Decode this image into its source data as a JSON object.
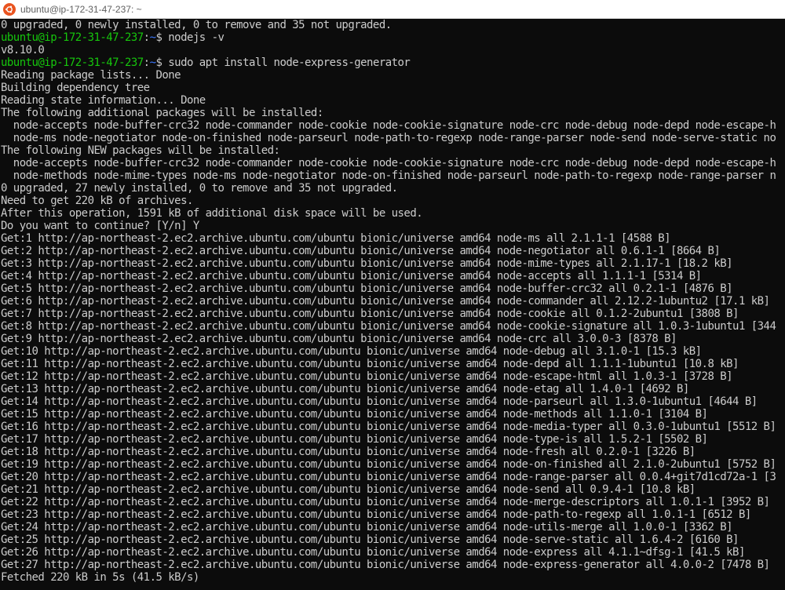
{
  "window": {
    "title": "ubuntu@ip-172-31-47-237: ~",
    "app_icon": "ubuntu-logo-icon",
    "accent": "#e95420"
  },
  "colors": {
    "background": "#0c0c0c",
    "text": "#cccccc",
    "prompt_user": "#16c60c",
    "prompt_path": "#3b78ff"
  },
  "terminal": {
    "lines": [
      {
        "type": "out",
        "text": "0 upgraded, 0 newly installed, 0 to remove and 35 not upgraded."
      },
      {
        "type": "prompt",
        "user": "ubuntu@ip-172-31-47-237",
        "sep": ":",
        "path": "~",
        "cmd": "$ nodejs -v"
      },
      {
        "type": "out",
        "text": "v8.10.0"
      },
      {
        "type": "prompt",
        "user": "ubuntu@ip-172-31-47-237",
        "sep": ":",
        "path": "~",
        "cmd": "$ sudo apt install node-express-generator"
      },
      {
        "type": "out",
        "text": "Reading package lists... Done"
      },
      {
        "type": "out",
        "text": "Building dependency tree"
      },
      {
        "type": "out",
        "text": "Reading state information... Done"
      },
      {
        "type": "out",
        "text": "The following additional packages will be installed:"
      },
      {
        "type": "out",
        "text": "  node-accepts node-buffer-crc32 node-commander node-cookie node-cookie-signature node-crc node-debug node-depd node-escape-h"
      },
      {
        "type": "out",
        "text": "  node-ms node-negotiator node-on-finished node-parseurl node-path-to-regexp node-range-parser node-send node-serve-static no"
      },
      {
        "type": "out",
        "text": "The following NEW packages will be installed:"
      },
      {
        "type": "out",
        "text": "  node-accepts node-buffer-crc32 node-commander node-cookie node-cookie-signature node-crc node-debug node-depd node-escape-h"
      },
      {
        "type": "out",
        "text": "  node-methods node-mime-types node-ms node-negotiator node-on-finished node-parseurl node-path-to-regexp node-range-parser n"
      },
      {
        "type": "out",
        "text": "0 upgraded, 27 newly installed, 0 to remove and 35 not upgraded."
      },
      {
        "type": "out",
        "text": "Need to get 220 kB of archives."
      },
      {
        "type": "out",
        "text": "After this operation, 1591 kB of additional disk space will be used."
      },
      {
        "type": "out",
        "text": "Do you want to continue? [Y/n] Y"
      },
      {
        "type": "out",
        "text": "Get:1 http://ap-northeast-2.ec2.archive.ubuntu.com/ubuntu bionic/universe amd64 node-ms all 2.1.1-1 [4588 B]"
      },
      {
        "type": "out",
        "text": "Get:2 http://ap-northeast-2.ec2.archive.ubuntu.com/ubuntu bionic/universe amd64 node-negotiator all 0.6.1-1 [8664 B]"
      },
      {
        "type": "out",
        "text": "Get:3 http://ap-northeast-2.ec2.archive.ubuntu.com/ubuntu bionic/universe amd64 node-mime-types all 2.1.17-1 [18.2 kB]"
      },
      {
        "type": "out",
        "text": "Get:4 http://ap-northeast-2.ec2.archive.ubuntu.com/ubuntu bionic/universe amd64 node-accepts all 1.1.1-1 [5314 B]"
      },
      {
        "type": "out",
        "text": "Get:5 http://ap-northeast-2.ec2.archive.ubuntu.com/ubuntu bionic/universe amd64 node-buffer-crc32 all 0.2.1-1 [4876 B]"
      },
      {
        "type": "out",
        "text": "Get:6 http://ap-northeast-2.ec2.archive.ubuntu.com/ubuntu bionic/universe amd64 node-commander all 2.12.2-1ubuntu2 [17.1 kB]"
      },
      {
        "type": "out",
        "text": "Get:7 http://ap-northeast-2.ec2.archive.ubuntu.com/ubuntu bionic/universe amd64 node-cookie all 0.1.2-2ubuntu1 [3808 B]"
      },
      {
        "type": "out",
        "text": "Get:8 http://ap-northeast-2.ec2.archive.ubuntu.com/ubuntu bionic/universe amd64 node-cookie-signature all 1.0.3-1ubuntu1 [344"
      },
      {
        "type": "out",
        "text": "Get:9 http://ap-northeast-2.ec2.archive.ubuntu.com/ubuntu bionic/universe amd64 node-crc all 3.0.0-3 [8378 B]"
      },
      {
        "type": "out",
        "text": "Get:10 http://ap-northeast-2.ec2.archive.ubuntu.com/ubuntu bionic/universe amd64 node-debug all 3.1.0-1 [15.3 kB]"
      },
      {
        "type": "out",
        "text": "Get:11 http://ap-northeast-2.ec2.archive.ubuntu.com/ubuntu bionic/universe amd64 node-depd all 1.1.1-1ubuntu1 [10.8 kB]"
      },
      {
        "type": "out",
        "text": "Get:12 http://ap-northeast-2.ec2.archive.ubuntu.com/ubuntu bionic/universe amd64 node-escape-html all 1.0.3-1 [3728 B]"
      },
      {
        "type": "out",
        "text": "Get:13 http://ap-northeast-2.ec2.archive.ubuntu.com/ubuntu bionic/universe amd64 node-etag all 1.4.0-1 [4692 B]"
      },
      {
        "type": "out",
        "text": "Get:14 http://ap-northeast-2.ec2.archive.ubuntu.com/ubuntu bionic/universe amd64 node-parseurl all 1.3.0-1ubuntu1 [4644 B]"
      },
      {
        "type": "out",
        "text": "Get:15 http://ap-northeast-2.ec2.archive.ubuntu.com/ubuntu bionic/universe amd64 node-methods all 1.1.0-1 [3104 B]"
      },
      {
        "type": "out",
        "text": "Get:16 http://ap-northeast-2.ec2.archive.ubuntu.com/ubuntu bionic/universe amd64 node-media-typer all 0.3.0-1ubuntu1 [5512 B]"
      },
      {
        "type": "out",
        "text": "Get:17 http://ap-northeast-2.ec2.archive.ubuntu.com/ubuntu bionic/universe amd64 node-type-is all 1.5.2-1 [5502 B]"
      },
      {
        "type": "out",
        "text": "Get:18 http://ap-northeast-2.ec2.archive.ubuntu.com/ubuntu bionic/universe amd64 node-fresh all 0.2.0-1 [3226 B]"
      },
      {
        "type": "out",
        "text": "Get:19 http://ap-northeast-2.ec2.archive.ubuntu.com/ubuntu bionic/universe amd64 node-on-finished all 2.1.0-2ubuntu1 [5752 B]"
      },
      {
        "type": "out",
        "text": "Get:20 http://ap-northeast-2.ec2.archive.ubuntu.com/ubuntu bionic/universe amd64 node-range-parser all 0.0.4+git7d1cd72a-1 [3"
      },
      {
        "type": "out",
        "text": "Get:21 http://ap-northeast-2.ec2.archive.ubuntu.com/ubuntu bionic/universe amd64 node-send all 0.9.4-1 [10.8 kB]"
      },
      {
        "type": "out",
        "text": "Get:22 http://ap-northeast-2.ec2.archive.ubuntu.com/ubuntu bionic/universe amd64 node-merge-descriptors all 1.0.1-1 [3952 B]"
      },
      {
        "type": "out",
        "text": "Get:23 http://ap-northeast-2.ec2.archive.ubuntu.com/ubuntu bionic/universe amd64 node-path-to-regexp all 1.0.1-1 [6512 B]"
      },
      {
        "type": "out",
        "text": "Get:24 http://ap-northeast-2.ec2.archive.ubuntu.com/ubuntu bionic/universe amd64 node-utils-merge all 1.0.0-1 [3362 B]"
      },
      {
        "type": "out",
        "text": "Get:25 http://ap-northeast-2.ec2.archive.ubuntu.com/ubuntu bionic/universe amd64 node-serve-static all 1.6.4-2 [6160 B]"
      },
      {
        "type": "out",
        "text": "Get:26 http://ap-northeast-2.ec2.archive.ubuntu.com/ubuntu bionic/universe amd64 node-express all 4.1.1~dfsg-1 [41.5 kB]"
      },
      {
        "type": "out",
        "text": "Get:27 http://ap-northeast-2.ec2.archive.ubuntu.com/ubuntu bionic/universe amd64 node-express-generator all 4.0.0-2 [7478 B]"
      },
      {
        "type": "out",
        "text": "Fetched 220 kB in 5s (41.5 kB/s)"
      }
    ]
  }
}
